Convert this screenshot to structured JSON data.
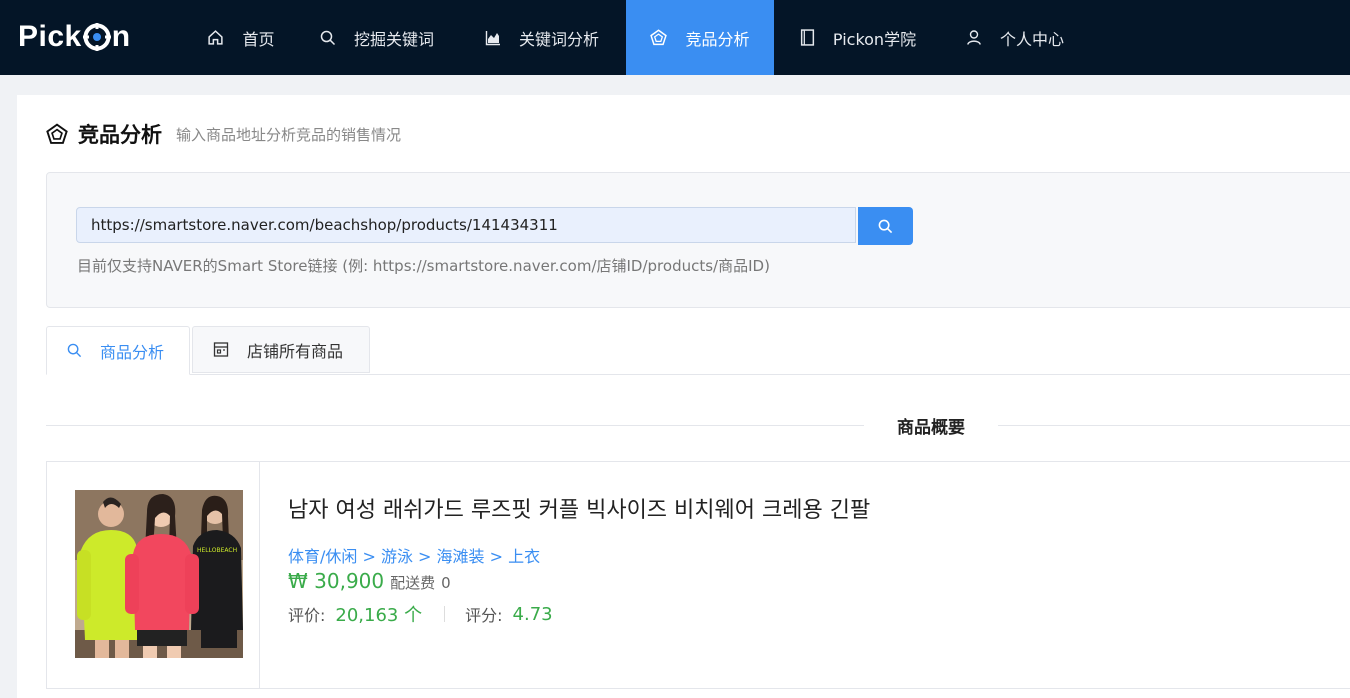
{
  "nav": {
    "logo": "PickOn",
    "items": [
      {
        "label": "首页",
        "icon": "home-icon"
      },
      {
        "label": "挖掘关键词",
        "icon": "search-icon"
      },
      {
        "label": "关键词分析",
        "icon": "chart-icon"
      },
      {
        "label": "竞品分析",
        "icon": "pentagon-icon",
        "active": true
      },
      {
        "label": "Pickon学院",
        "icon": "book-icon"
      },
      {
        "label": "个人中心",
        "icon": "user-icon"
      }
    ]
  },
  "page": {
    "title": "竞品分析",
    "subtitle": "输入商品地址分析竞品的销售情况"
  },
  "search": {
    "value": "https://smartstore.naver.com/beachshop/products/141434311",
    "hint": "目前仅支持NAVER的Smart Store链接 (例: https://smartstore.naver.com/店铺ID/products/商品ID)"
  },
  "tabs": [
    {
      "label": "商品分析",
      "active": true
    },
    {
      "label": "店铺所有商品",
      "active": false
    }
  ],
  "section": {
    "title": "商品概要"
  },
  "product": {
    "title": "남자 여성 래쉬가드 루즈핏 커플 빅사이즈 비치웨어 크레용 긴팔",
    "category": "体育/休闲 > 游泳 > 海滩装 > 上衣",
    "price": "₩ 30,900",
    "shipping_label": "配送费",
    "shipping_value": "0",
    "review_label": "评价:",
    "review_value": "20,163 个",
    "rating_label": "评分:",
    "rating_value": "4.73",
    "shirt_text": "HELLOBEACH"
  },
  "colors": {
    "nav_bg": "#041527",
    "accent": "#3a8ef2",
    "green": "#3aab4a"
  }
}
